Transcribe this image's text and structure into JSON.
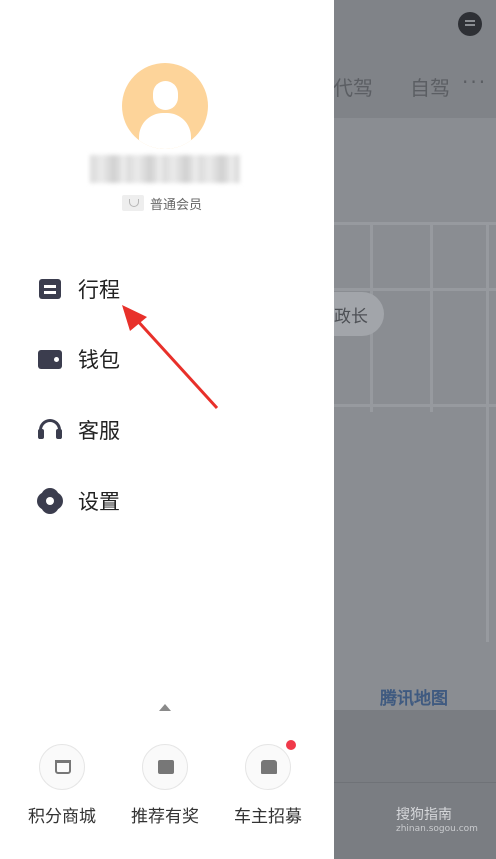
{
  "background_map": {
    "tabs": [
      "代驾",
      "自驾"
    ],
    "more_label": "···",
    "pill_label": "政长",
    "map_logo": "腾讯地图",
    "watermark": "搜狗指南",
    "watermark_sub": "zhinan.sogou.com"
  },
  "drawer": {
    "username": "",
    "member_label": "普通会员",
    "menu": [
      {
        "label": "行程",
        "icon": "trip-icon"
      },
      {
        "label": "钱包",
        "icon": "wallet-icon"
      },
      {
        "label": "客服",
        "icon": "headset-icon"
      },
      {
        "label": "设置",
        "icon": "gear-icon"
      }
    ],
    "bottom": [
      {
        "label": "积分商城",
        "icon": "cart-icon",
        "has_badge": false
      },
      {
        "label": "推荐有奖",
        "icon": "gift-icon",
        "has_badge": false
      },
      {
        "label": "车主招募",
        "icon": "driver-icon",
        "has_badge": true
      }
    ]
  },
  "colors": {
    "accent_red": "#f0394a",
    "icon_dark": "#3b3d4e",
    "avatar_bg": "#fdd49a"
  }
}
